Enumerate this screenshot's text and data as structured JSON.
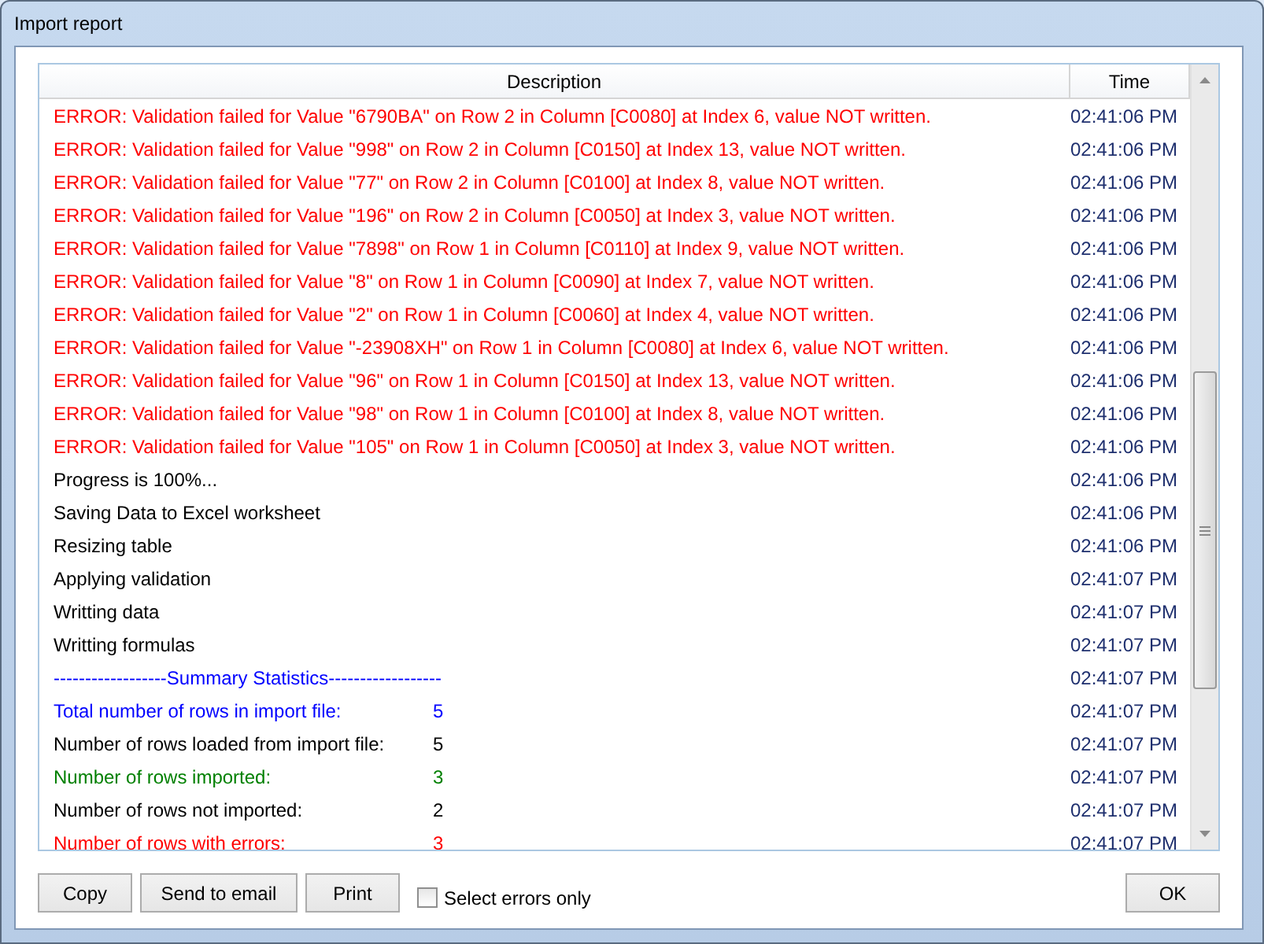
{
  "window": {
    "title": "Import report"
  },
  "table": {
    "columns": [
      "Description",
      "Time"
    ],
    "rows": [
      {
        "text": "ERROR: Validation failed for Value \"6790BA\" on Row 2 in Column [C0080] at Index 6, value NOT written.",
        "time": "02:41:06 PM",
        "color": "#ff0000"
      },
      {
        "text": "ERROR: Validation failed for Value \"998\" on Row 2 in Column [C0150] at Index 13, value NOT written.",
        "time": "02:41:06 PM",
        "color": "#ff0000"
      },
      {
        "text": "ERROR: Validation failed for Value \"77\" on Row 2 in Column [C0100] at Index 8, value NOT written.",
        "time": "02:41:06 PM",
        "color": "#ff0000"
      },
      {
        "text": "ERROR: Validation failed for Value \"196\" on Row 2 in Column [C0050] at Index 3, value NOT written.",
        "time": "02:41:06 PM",
        "color": "#ff0000"
      },
      {
        "text": "ERROR: Validation failed for Value \"7898\" on Row 1 in Column [C0110] at Index 9, value NOT written.",
        "time": "02:41:06 PM",
        "color": "#ff0000"
      },
      {
        "text": "ERROR: Validation failed for Value \"8\" on Row 1 in Column [C0090] at Index 7, value NOT written.",
        "time": "02:41:06 PM",
        "color": "#ff0000"
      },
      {
        "text": "ERROR: Validation failed for Value \"2\" on Row 1 in Column [C0060] at Index 4, value NOT written.",
        "time": "02:41:06 PM",
        "color": "#ff0000"
      },
      {
        "text": "ERROR: Validation failed for Value \"-23908XH\" on Row 1 in Column [C0080] at Index 6, value NOT written.",
        "time": "02:41:06 PM",
        "color": "#ff0000"
      },
      {
        "text": "ERROR: Validation failed for Value \"96\" on Row 1 in Column [C0150] at Index 13, value NOT written.",
        "time": "02:41:06 PM",
        "color": "#ff0000"
      },
      {
        "text": "ERROR: Validation failed for Value \"98\" on Row 1 in Column [C0100] at Index 8, value NOT written.",
        "time": "02:41:06 PM",
        "color": "#ff0000"
      },
      {
        "text": "ERROR: Validation failed for Value \"105\" on Row 1 in Column [C0050] at Index 3, value NOT written.",
        "time": "02:41:06 PM",
        "color": "#ff0000"
      },
      {
        "text": "Progress is 100%...",
        "time": "02:41:06 PM",
        "color": "#000000"
      },
      {
        "text": "Saving Data to Excel worksheet",
        "time": "02:41:06 PM",
        "color": "#000000"
      },
      {
        "text": "Resizing table",
        "time": "02:41:06 PM",
        "color": "#000000"
      },
      {
        "text": "Applying validation",
        "time": "02:41:07 PM",
        "color": "#000000"
      },
      {
        "text": "Writting data",
        "time": "02:41:07 PM",
        "color": "#000000"
      },
      {
        "text": "Writting formulas",
        "time": "02:41:07 PM",
        "color": "#000000"
      },
      {
        "text": "------------------Summary Statistics------------------",
        "time": "02:41:07 PM",
        "color": "#0000ff"
      },
      {
        "text": "Total number of rows in import file:",
        "value": "5",
        "time": "02:41:07 PM",
        "color": "#0000ff"
      },
      {
        "text": "Number of rows loaded from import file:",
        "value": "5",
        "time": "02:41:07 PM",
        "color": "#000000"
      },
      {
        "text": "Number of rows imported:",
        "value": "3",
        "time": "02:41:07 PM",
        "color": "#008000"
      },
      {
        "text": "Number of rows not imported:",
        "value": "2",
        "time": "02:41:07 PM",
        "color": "#000000"
      },
      {
        "text": "Number of rows with errors:",
        "value": "3",
        "time": "02:41:07 PM",
        "color": "#ff0000"
      }
    ]
  },
  "buttons": [
    "Copy",
    "Send to email",
    "Print"
  ],
  "checkbox": {
    "label": "Select errors only",
    "checked": false
  },
  "ok_button": "OK"
}
